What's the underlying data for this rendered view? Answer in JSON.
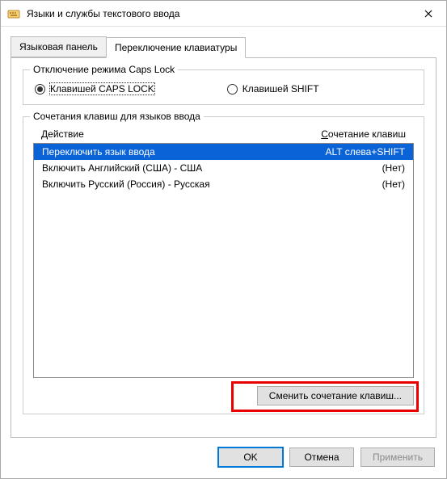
{
  "window": {
    "title": "Языки и службы текстового ввода"
  },
  "tabs": [
    {
      "label": "Языковая панель",
      "active": false
    },
    {
      "label": "Переключение клавиатуры",
      "active": true
    }
  ],
  "capslock_group": {
    "title": "Отключение режима Caps Lock",
    "options": [
      {
        "label": "Клавишей CAPS LOCK",
        "selected": true
      },
      {
        "label": "Клавишей SHIFT",
        "selected": false
      }
    ]
  },
  "hotkeys_group": {
    "title": "Сочетания клавиш для языков ввода",
    "headers": {
      "action": "Действие",
      "combo": "Сочетание клавиш"
    },
    "rows": [
      {
        "action": "Переключить язык ввода",
        "combo": "ALT слева+SHIFT",
        "selected": true
      },
      {
        "action": "Включить Английский (США) - США",
        "combo": "(Нет)",
        "selected": false
      },
      {
        "action": "Включить Русский (Россия) - Русская",
        "combo": "(Нет)",
        "selected": false
      }
    ],
    "change_button": "Сменить сочетание клавиш..."
  },
  "footer": {
    "ok": "OK",
    "cancel": "Отмена",
    "apply": "Применить"
  }
}
